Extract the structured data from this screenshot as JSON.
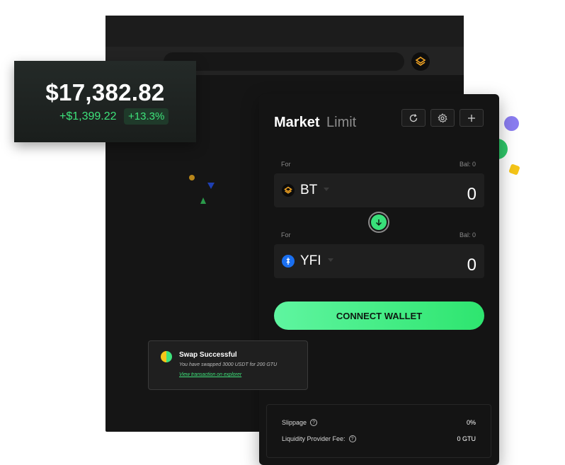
{
  "balance": {
    "value": "$17,382.82",
    "change": "+$1,399.22",
    "change_pct": "+13.3%"
  },
  "swap": {
    "tabs": {
      "market": "Market",
      "limit": "Limit"
    },
    "icons": [
      "refresh-icon",
      "gear-icon",
      "plus-icon"
    ],
    "from": {
      "label": "For",
      "balance": "Bal: 0",
      "token": "BT",
      "amount": "0"
    },
    "to": {
      "label": "For",
      "balance": "Bal: 0",
      "token": "YFI",
      "amount": "0"
    },
    "connect_label": "CONNECT WALLET",
    "slippage_label": "Slippage",
    "slippage_value": "0%",
    "fee_label": "Liquidity Provider Fee:",
    "fee_value": "0 GTU"
  },
  "toast": {
    "title": "Swap Successful",
    "body": "You have swapped 3000 USDT for 200 GTU",
    "link": "View transaction on explorer"
  },
  "colors": {
    "accent": "#3ee37b",
    "panel": "#141414",
    "bt_token": "#f5a623",
    "yfi_token": "#1a6ff0"
  }
}
